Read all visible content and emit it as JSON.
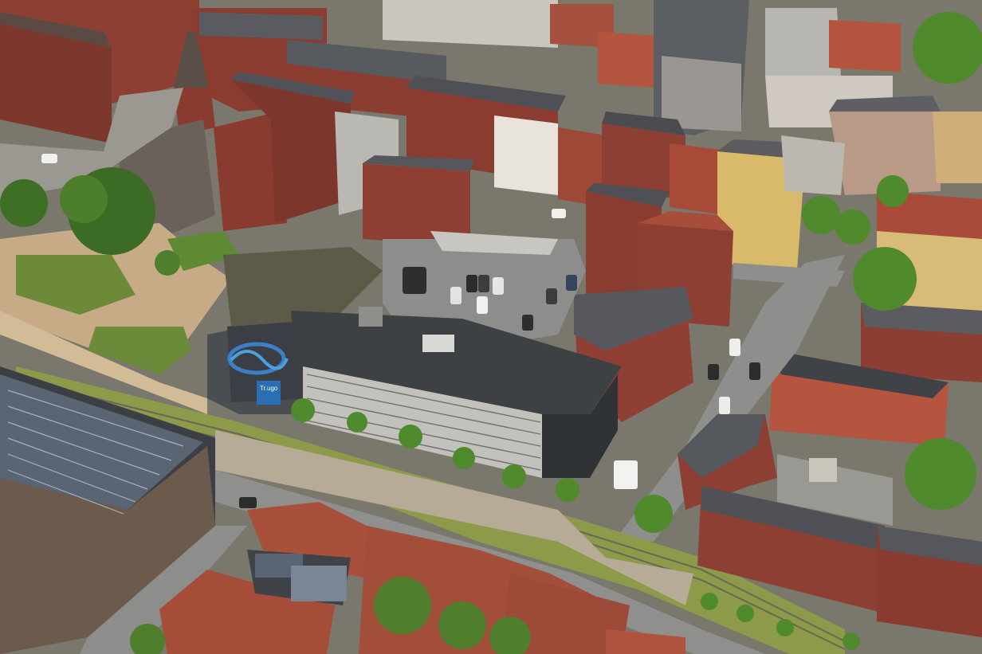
{
  "image": {
    "kind": "aerial-photograph",
    "visible_text": {
      "facade_sign": "Tr.ugo"
    }
  },
  "palette": {
    "brick_red": "#8e3f33",
    "roof_tile": "#a9503d",
    "slate_roof": "#4f5156",
    "flat_roof": "#3f4244",
    "asphalt": "#8a8b89",
    "tram_grass": "#8c9a4a",
    "tree_green": "#4f7f2c",
    "yellow_house": "#d9b96a",
    "solar_panel": "#5b6472"
  }
}
